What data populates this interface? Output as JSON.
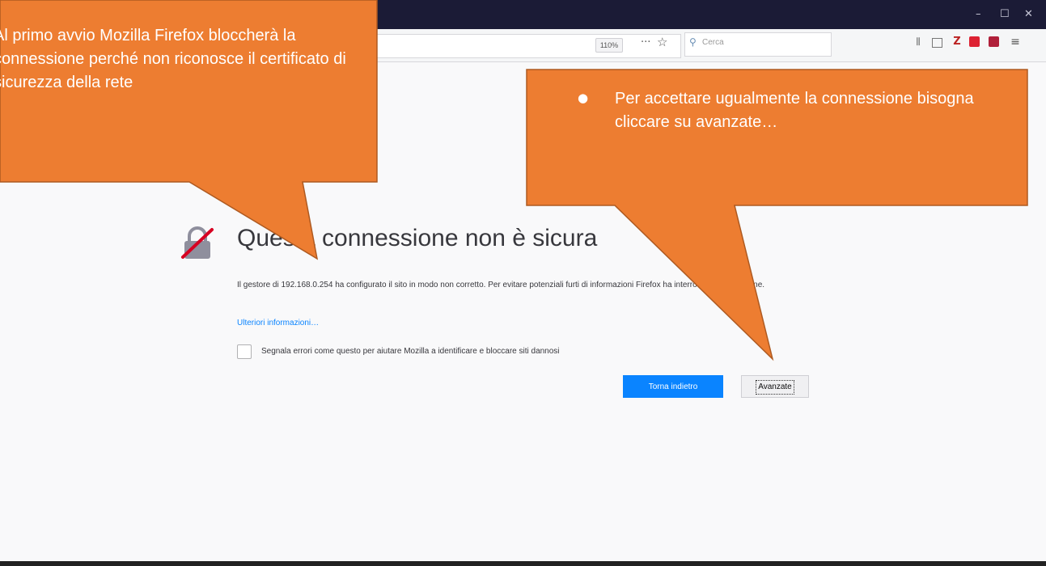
{
  "browser": {
    "window_controls": {
      "minimize": "–",
      "restore": "☐",
      "close": "✕"
    },
    "zoom": "110%",
    "page_actions": "···",
    "bookmark_icon": "star-icon",
    "search": {
      "placeholder": "Cerca"
    },
    "toolbar_icons": [
      "library-icon",
      "sidebar-icon",
      "zotero-icon",
      "pocket-icon",
      "pdf-icon",
      "menu-icon"
    ]
  },
  "error_page": {
    "title": "Questa connessione non è sicura",
    "description": "Il gestore di 192.168.0.254 ha configurato il sito in modo non corretto. Per evitare potenziali furti di informazioni Firefox ha interrotto la connessione.",
    "learn_more": "Ulteriori informazioni…",
    "report_checkbox": "Segnala errori come questo per aiutare Mozilla a identificare e bloccare siti dannosi",
    "back_button": "Torna indietro",
    "advanced_button": "Avanzate"
  },
  "callouts": {
    "left": "Al primo avvio Mozilla Firefox bloccherà la connessione perché non riconosce il certificato di sicurezza della rete",
    "right": "Per accettare ugualmente la connessione bisogna cliccare su avanzate…"
  },
  "colors": {
    "callout": "#ed7d31",
    "callout_border": "#ae5a21",
    "primary_button": "#0a84ff",
    "titlebar": "#1b1b36"
  }
}
